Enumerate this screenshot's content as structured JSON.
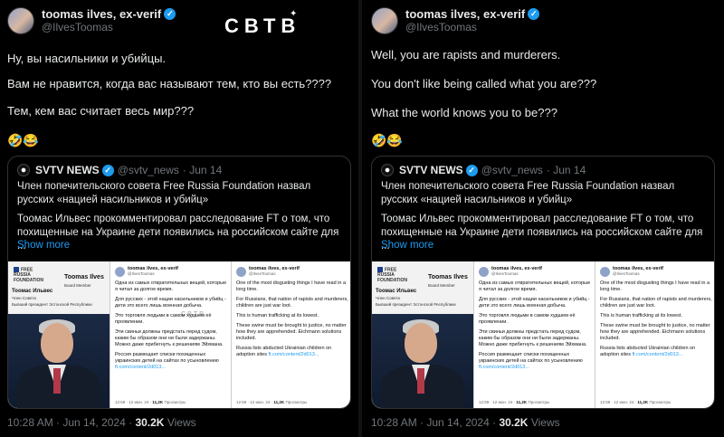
{
  "watermark": "СВТВ",
  "author": {
    "name": "toomas ilves, ex-verif",
    "handle": "@IlvesToomas"
  },
  "left_tweet": {
    "lines": [
      "Ну, вы насильники и убийцы.",
      "Вам не нравится, когда вас называют тем, кто вы есть????",
      "Тем, кем вас считает весь мир???"
    ],
    "emoji": "🤣😂"
  },
  "right_tweet": {
    "lines": [
      "Well, you are rapists and murderers.",
      "You don't like being called what you are???",
      "What the world knows you to be???"
    ],
    "emoji": "🤣😂"
  },
  "quote": {
    "name": "SVTV NEWS",
    "handle": "@svtv_news",
    "date": "· Jun 14",
    "headline": "Член попечительского совета Free Russia Foundation назвал русских «нацией насильников и убийц»",
    "body": "Тоомас Ильвес прокомментировал расследование FT о том, что похищенные на Украине дети появились на российском сайте для ...",
    "show_more": "Show more"
  },
  "media": {
    "org_line1": "FREE",
    "org_line2": "RUSSIA",
    "org_line3": "FOUNDATION",
    "bio_name": "Toomas Ilves",
    "bio_role": "Board Member",
    "ru_name": "Тоомас Ильвес",
    "ru_role": "Член Совета",
    "ru_desc": "Бывший президент Эстонской Республики",
    "ss_name": "toomas ilves, ex-verif",
    "ss_handle": "@IlvesToomas",
    "ru_paras": [
      "Одна из самых отвратительных вещей, которые я читал за долгое время.",
      "Для русских - этой нации насильников и убийц - дети это всего лишь военная добыча.",
      "Это торговля людьми в самом худшем её проявлении.",
      "Эти свиньи должны предстать перед судом, каким бы образом они ни были задержаны. Можно даже прибегнуть к решениям Эйхмана.",
      "Россия размещает списки похищенных украинских детей на сайтах по усыновлению"
    ],
    "ru_link": "ft.com/content/2d013...",
    "ru_foot_time": "12:59 · 12 июн. 24 ·",
    "ru_foot_views": "11,2K",
    "ru_foot_label": "Просмотры",
    "en_paras": [
      "One of the most disgusting things I have read in a long time.",
      "For Russians, that nation of rapists and murderers, children are just war loot.",
      "This is human trafficking at its lowest.",
      "These swine must be brought to justice, no matter how they are apprehended. Eichmann solutions included.",
      "Russia lists abducted Ukrainian children on adoption sites"
    ],
    "en_link": "ft.com/content/2d013...",
    "ss_watermark": "СВТВ"
  },
  "footer": {
    "time": "10:28 AM · Jun 14, 2024 ·",
    "views": "30.2K",
    "views_label": "Views"
  }
}
